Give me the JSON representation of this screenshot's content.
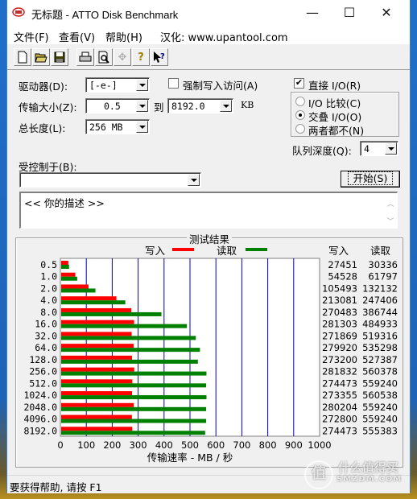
{
  "window": {
    "title": "无标题 - ATTO Disk Benchmark",
    "minimize": "—",
    "maximize": "☐",
    "close": "✕"
  },
  "menu": {
    "items": [
      {
        "label": "文件(F)"
      },
      {
        "label": "查看(V)"
      },
      {
        "label": "帮助(H)"
      }
    ],
    "localization": "汉化: www.upantool.com"
  },
  "toolbar": {
    "buttons": [
      {
        "icon": "new-document-icon",
        "glyph": "🗋"
      },
      {
        "icon": "open-folder-icon",
        "glyph": "📂"
      },
      {
        "icon": "save-icon",
        "glyph": "💾"
      },
      {
        "icon": "print-icon",
        "glyph": "🖶"
      },
      {
        "icon": "print-preview-icon",
        "glyph": "🔍"
      },
      {
        "icon": "move-icon",
        "glyph": "✥"
      },
      {
        "icon": "help-icon",
        "glyph": "?"
      },
      {
        "icon": "context-help-icon",
        "glyph": "↖?"
      }
    ]
  },
  "settings": {
    "drive_label": "驱动器(D):",
    "drive_value": "[-e-]",
    "transfer_size_label": "传输大小(Z):",
    "transfer_from": "0.5",
    "to_label": "到",
    "transfer_to": "8192.0",
    "unit": "KB",
    "total_length_label": "总长度(L):",
    "total_length_value": "256 MB",
    "force_write_label": "强制写入访问(A)",
    "force_write_checked": false,
    "direct_io_label": "直接 I/O(R)",
    "direct_io_checked": true,
    "io_compare_label": "I/O 比较(C)",
    "overlapped_io_label": "交叠 I/O(O)",
    "neither_label": "两者都不(N)",
    "selected_mode": "overlapped",
    "queue_depth_label": "队列深度(Q):",
    "queue_depth_value": "4",
    "controlled_by_label": "受控制于(B):",
    "controlled_by_value": "",
    "start_button": "开始(S)",
    "description": "<<   你的描述    >>"
  },
  "results": {
    "group_title": "测试结果",
    "legend_write": "写入",
    "legend_read": "读取",
    "col_write": "写入",
    "col_read": "读取",
    "xlabel": "传输速率 - MB / 秒",
    "colors": {
      "write": "#ff0000",
      "read": "#008000",
      "grid": "#0000c0"
    }
  },
  "chart_data": {
    "type": "bar",
    "orientation": "horizontal",
    "title": "测试结果",
    "xlabel": "传输速率 - MB / 秒",
    "ylabel": "",
    "xlim": [
      0,
      1000
    ],
    "xticks": [
      0,
      100,
      200,
      300,
      400,
      500,
      600,
      700,
      800,
      900,
      1000
    ],
    "grid": true,
    "legend": "top",
    "categories": [
      "0.5",
      "1.0",
      "2.0",
      "4.0",
      "8.0",
      "16.0",
      "32.0",
      "64.0",
      "128.0",
      "256.0",
      "512.0",
      "1024.0",
      "2048.0",
      "4096.0",
      "8192.0"
    ],
    "series": [
      {
        "name": "写入",
        "values": [
          27451,
          54528,
          105493,
          213081,
          270483,
          281303,
          271869,
          279920,
          273200,
          281832,
          274473,
          273355,
          280204,
          272800,
          274473
        ]
      },
      {
        "name": "读取",
        "values": [
          30336,
          61797,
          132132,
          247406,
          386744,
          484933,
          519316,
          535298,
          527387,
          560378,
          559240,
          560538,
          559240,
          559240,
          555383
        ]
      }
    ],
    "value_unit": "KB/s"
  },
  "status": {
    "text": "要获得帮助, 请按 F1"
  },
  "watermark": {
    "symbol": "值",
    "main": "什么值得买",
    "sub": "SMZDM.COM"
  }
}
